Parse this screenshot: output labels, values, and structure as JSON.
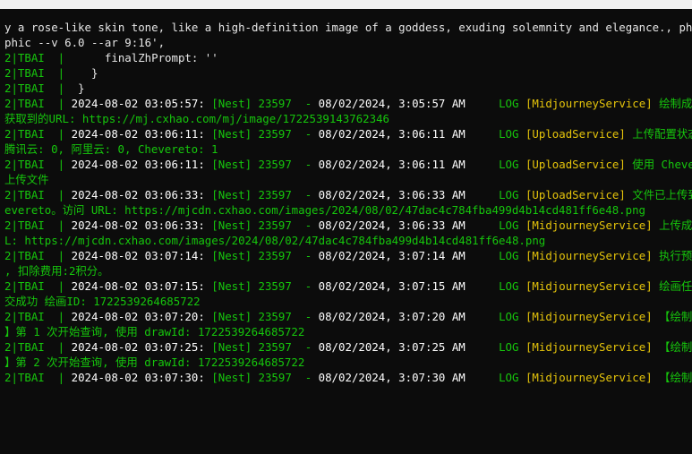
{
  "terminal": {
    "wrap1": "y a rose-like skin tone, like a high-definition image of a goddess, exuding solemnity and elegance., photogra",
    "wrap2": "phic --v 6.0 --ar 9:16',",
    "prefix": "2|TBAI  |",
    "zh_prompt": "      finalZhPrompt: ''",
    "close1": "    }",
    "close2": "  }",
    "pid": "[Nest] 23597  - ",
    "level": "LOG",
    "rows": [
      {
        "ts": "2024-08-02 03:05:57:",
        "time": "08/02/2024, 3:05:57 AM",
        "ctx": "[MidjourneyService]",
        "msg": " 绘制成功,",
        "cont": "获取到的URL: https://mj.cxhao.com/mj/image/1722539143762346"
      },
      {
        "ts": "2024-08-02 03:06:11:",
        "time": "08/02/2024, 3:06:11 AM",
        "ctx": "[UploadService]",
        "msg": " 上传配置状态 -",
        "cont": "腾讯云: 0, 阿里云: 0, Chevereto: 1"
      },
      {
        "ts": "2024-08-02 03:06:11:",
        "time": "08/02/2024, 3:06:11 AM",
        "ctx": "[UploadService]",
        "msg": " 使用 Chevereto",
        "cont": "上传文件"
      },
      {
        "ts": "2024-08-02 03:06:33:",
        "time": "08/02/2024, 3:06:33 AM",
        "ctx": "[UploadService]",
        "msg": " 文件已上传到 Ch",
        "cont": "evereto。访问 URL: https://mjcdn.cxhao.com/images/2024/08/02/47dac4c784fba499d4b14cd481ff6e48.png"
      },
      {
        "ts": "2024-08-02 03:06:33:",
        "time": "08/02/2024, 3:06:33 AM",
        "ctx": "[MidjourneyService]",
        "msg": " 上传成功 UR",
        "cont": "L: https://mjcdn.cxhao.com/images/2024/08/02/47dac4c784fba499d4b14cd481ff6e48.png"
      },
      {
        "ts": "2024-08-02 03:07:14:",
        "time": "08/02/2024, 3:07:14 AM",
        "ctx": "[MidjourneyService]",
        "msg": " 执行预扣费",
        "cont": ", 扣除费用:2积分。"
      },
      {
        "ts": "2024-08-02 03:07:15:",
        "time": "08/02/2024, 3:07:15 AM",
        "ctx": "[MidjourneyService]",
        "msg": " 绘画任务提",
        "cont": "交成功 绘画ID: 1722539264685722"
      },
      {
        "ts": "2024-08-02 03:07:20:",
        "time": "08/02/2024, 3:07:20 AM",
        "ctx": "[MidjourneyService]",
        "msg": " 【绘制图片",
        "cont": "】第 1 次开始查询, 使用 drawId: 1722539264685722"
      },
      {
        "ts": "2024-08-02 03:07:25:",
        "time": "08/02/2024, 3:07:25 AM",
        "ctx": "[MidjourneyService]",
        "msg": " 【绘制图片",
        "cont": "】第 2 次开始查询, 使用 drawId: 1722539264685722"
      },
      {
        "ts": "2024-08-02 03:07:30:",
        "time": "08/02/2024, 3:07:30 AM",
        "ctx": "[MidjourneyService]",
        "msg": " 【绘制图片",
        "cont": ""
      }
    ]
  },
  "colors": {
    "background": "#0c0c0c",
    "text": "#e6e6e6",
    "green": "#16c60c",
    "yellow": "#e5c40b"
  }
}
